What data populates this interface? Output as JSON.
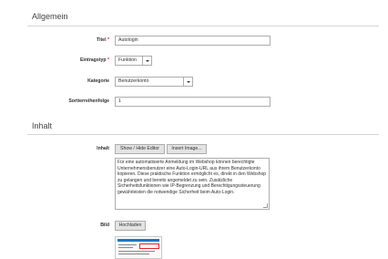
{
  "sections": {
    "general": "Allgemein",
    "content": "Inhalt"
  },
  "fields": {
    "title": {
      "label": "Titel",
      "value": "Autologin"
    },
    "entry_type": {
      "label": "Eintragstyp",
      "value": "Funktion"
    },
    "category": {
      "label": "Kategorie",
      "value": "Benutzerkonto"
    },
    "sort_order": {
      "label": "Sortierreihenfolge",
      "value": "1"
    },
    "content": {
      "label": "Inhalt",
      "show_hide_editor": "Show / Hide Editor",
      "insert_image": "Insert Image...",
      "text": "Für eine automatisierte Anmeldung im Webshop können berechtigte Unternehmensbenutzer eine Auto-Login-URL aus ihrem Benutzerkonto kopieren. Diese praktische Funktion ermöglicht es, direkt in den Webshop zu gelangen und bereits angemeldet zu sein. Zusätzliche Sicherheitsfunktionen wie IP-Begrenzung und Berechtigungssteuerung gewährleisten die notwendige Sicherheit beim Auto-Login."
    },
    "image": {
      "label": "Bild",
      "upload": "Hochladen"
    }
  },
  "required_marker": "*"
}
